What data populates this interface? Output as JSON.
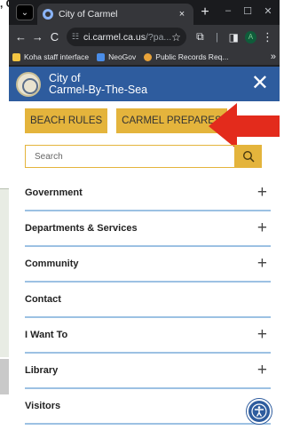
{
  "background": {
    "corner_text": ", C"
  },
  "browser": {
    "tab": {
      "title": "City of Carmel",
      "close": "×",
      "new_tab": "+"
    },
    "window_controls": {
      "minimize": "–",
      "maximize": "☐",
      "close": "✕"
    },
    "address_bar": {
      "back": "←",
      "forward": "→",
      "reload": "C",
      "url_host": "ci.carmel.ca.us",
      "url_path": "/?pa...",
      "star": "☆",
      "profile": "A",
      "menu": "⋮"
    },
    "bookmarks": [
      {
        "label": "Koha staff interface",
        "color": "#f4c542"
      },
      {
        "label": "NeoGov",
        "color": "#4a8de8"
      },
      {
        "label": "Public Records Req...",
        "color": "#e8a33a"
      }
    ],
    "bookmarks_more": "»"
  },
  "site": {
    "title_line1": "City of",
    "title_line2": "Carmel-By-The-Sea",
    "close_icon": "✕",
    "buttons": [
      "BEACH RULES",
      "CARMEL PREPARES"
    ],
    "search_placeholder": "Search",
    "nav": [
      {
        "label": "Government",
        "expand": "+"
      },
      {
        "label": "Departments & Services",
        "expand": "+"
      },
      {
        "label": "Community",
        "expand": "+"
      },
      {
        "label": "Contact",
        "expand": ""
      },
      {
        "label": "I Want To",
        "expand": "+"
      },
      {
        "label": "Library",
        "expand": "+"
      },
      {
        "label": "Visitors",
        "expand": ""
      }
    ]
  },
  "colors": {
    "header_blue": "#2e5c9e",
    "accent_gold": "#e4b43c",
    "divider_blue": "#9cc1e3",
    "arrow_red": "#e32b1c"
  }
}
